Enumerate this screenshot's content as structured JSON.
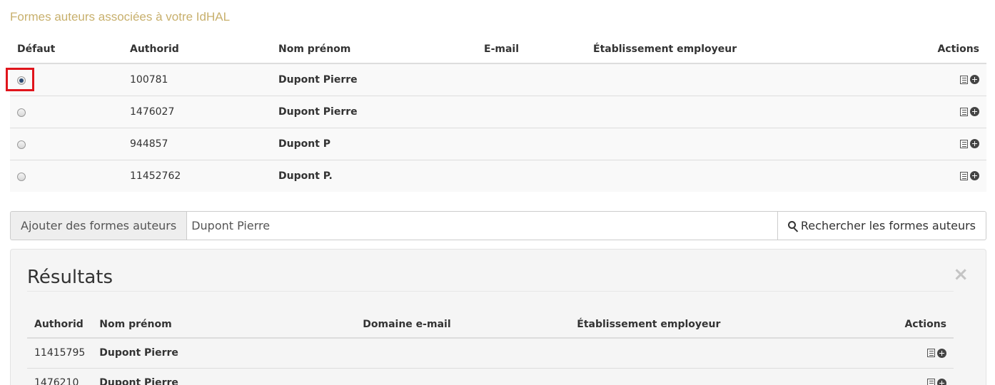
{
  "section": {
    "title": "Formes auteurs associées à votre IdHAL"
  },
  "authors_table": {
    "headers": {
      "default": "Défaut",
      "authorid": "Authorid",
      "name": "Nom prénom",
      "email": "E-mail",
      "employer": "Établissement employeur",
      "actions": "Actions"
    },
    "rows": [
      {
        "default": true,
        "authorid": "100781",
        "name": "Dupont Pierre",
        "email": "",
        "employer": ""
      },
      {
        "default": false,
        "authorid": "1476027",
        "name": "Dupont Pierre",
        "email": "",
        "employer": ""
      },
      {
        "default": false,
        "authorid": "944857",
        "name": "Dupont P",
        "email": "",
        "employer": ""
      },
      {
        "default": false,
        "authorid": "11452762",
        "name": "Dupont P.",
        "email": "",
        "employer": ""
      }
    ]
  },
  "search": {
    "addon_label": "Ajouter des formes auteurs",
    "value": "Dupont Pierre",
    "button_label": "Rechercher les formes auteurs"
  },
  "results": {
    "title": "Résultats",
    "close": "×",
    "headers": {
      "authorid": "Authorid",
      "name": "Nom prénom",
      "email_domain": "Domaine e-mail",
      "employer": "Établissement employeur",
      "actions": "Actions"
    },
    "rows": [
      {
        "authorid": "11415795",
        "name": "Dupont Pierre",
        "email_domain": "",
        "employer": ""
      },
      {
        "authorid": "1476210",
        "name": "Dupont Pierre",
        "email_domain": "",
        "employer": ""
      }
    ]
  },
  "icons": {
    "details": "list-icon",
    "add": "plus-circle-icon",
    "search": "search-icon"
  },
  "colors": {
    "title": "#c8b06d",
    "highlight": "#e0151c"
  }
}
